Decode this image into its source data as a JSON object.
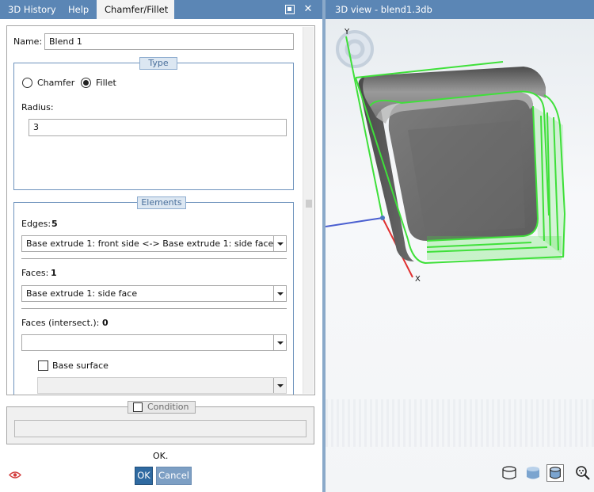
{
  "left_panel": {
    "tabs": [
      {
        "label": "3D History"
      },
      {
        "label": "Help"
      },
      {
        "label": "Chamfer/Fillet",
        "active": true
      }
    ],
    "maximize_icon": "maximize-icon",
    "close_icon": "close-icon",
    "close_glyph": "✕",
    "form": {
      "name_label": "Name:",
      "name_value": "Blend 1",
      "type_group": {
        "title": "Type",
        "chamfer_label": "Chamfer",
        "fillet_label": "Fillet",
        "selected": "Fillet",
        "radius_label": "Radius:",
        "radius_value": "3"
      },
      "elements_group": {
        "title": "Elements",
        "edges_label": "Edges:",
        "edges_count": "5",
        "edges_value": "Base extrude 1: front side <-> Base extrude 1: side face",
        "faces_label": "Faces:",
        "faces_count": "1",
        "faces_value": "Base extrude 1: side face",
        "faces_intersect_label": "Faces (intersect.):",
        "faces_intersect_count": "0",
        "faces_intersect_value": "",
        "base_surface_label": "Base surface",
        "base_surface_checked": false,
        "base_surface_value": ""
      }
    },
    "condition": {
      "title": "Condition",
      "checked": false,
      "value": ""
    },
    "status_text": "OK.",
    "ok_label": "OK",
    "cancel_label": "Cancel",
    "eye_icon": "eye-icon"
  },
  "view_panel": {
    "tab_label": "3D view - blend1.3db",
    "axes": {
      "y_label": "Y",
      "x_label": "X"
    },
    "toolbar_icons": [
      "cylinder-outline-icon",
      "cylinder-shaded-icon",
      "cylinder-shaded-edges-icon",
      "zoom-icon"
    ],
    "active_icon": "cylinder-shaded-edges-icon"
  },
  "colors": {
    "tab_bar": "#5b86b5",
    "group_border": "#6e93bd",
    "ok_button": "#2f6aa1",
    "highlight_green": "#3fe03a",
    "model_gray": "#6f6f6f"
  }
}
